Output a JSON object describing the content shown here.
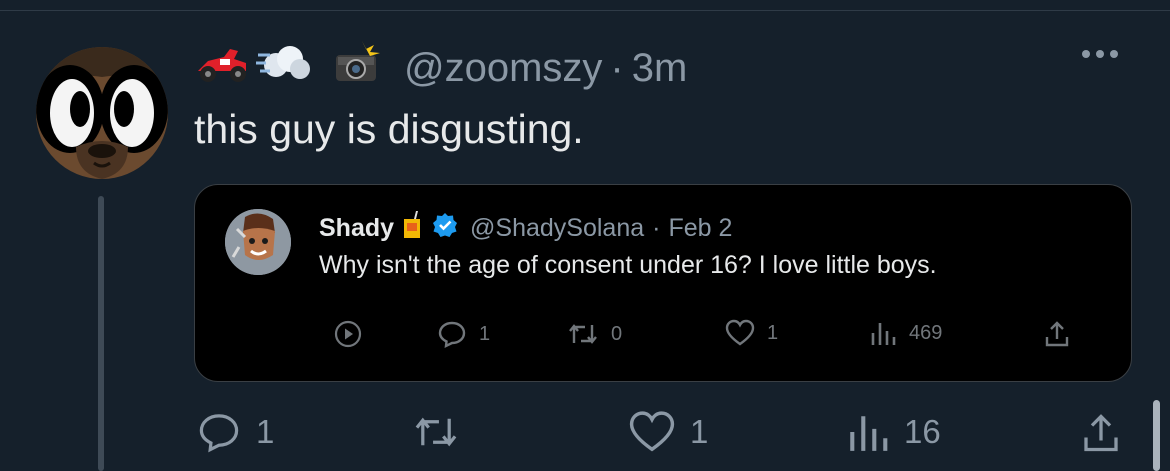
{
  "tweet": {
    "handle": "@zoomszy",
    "separator": "·",
    "time": "3m",
    "text": "this guy is disgusting.",
    "emoji_icons": [
      "race-car-emoji",
      "dash-emoji",
      "camera-flash-emoji"
    ],
    "actions": {
      "replies": "1",
      "likes": "1",
      "views": "16"
    }
  },
  "quoted": {
    "name": "Shady",
    "handle": "@ShadySolana",
    "separator": "·",
    "date": "Feb 2",
    "text": "Why isn't the age of consent under 16? I love little boys.",
    "actions": {
      "replies": "1",
      "retweets": "0",
      "likes": "1",
      "views": "469"
    }
  },
  "colors": {
    "background": "#15202b",
    "quote_background": "#000000",
    "text": "#e7e9ea",
    "muted": "#8b98a5",
    "verified": "#1d9bf0"
  }
}
